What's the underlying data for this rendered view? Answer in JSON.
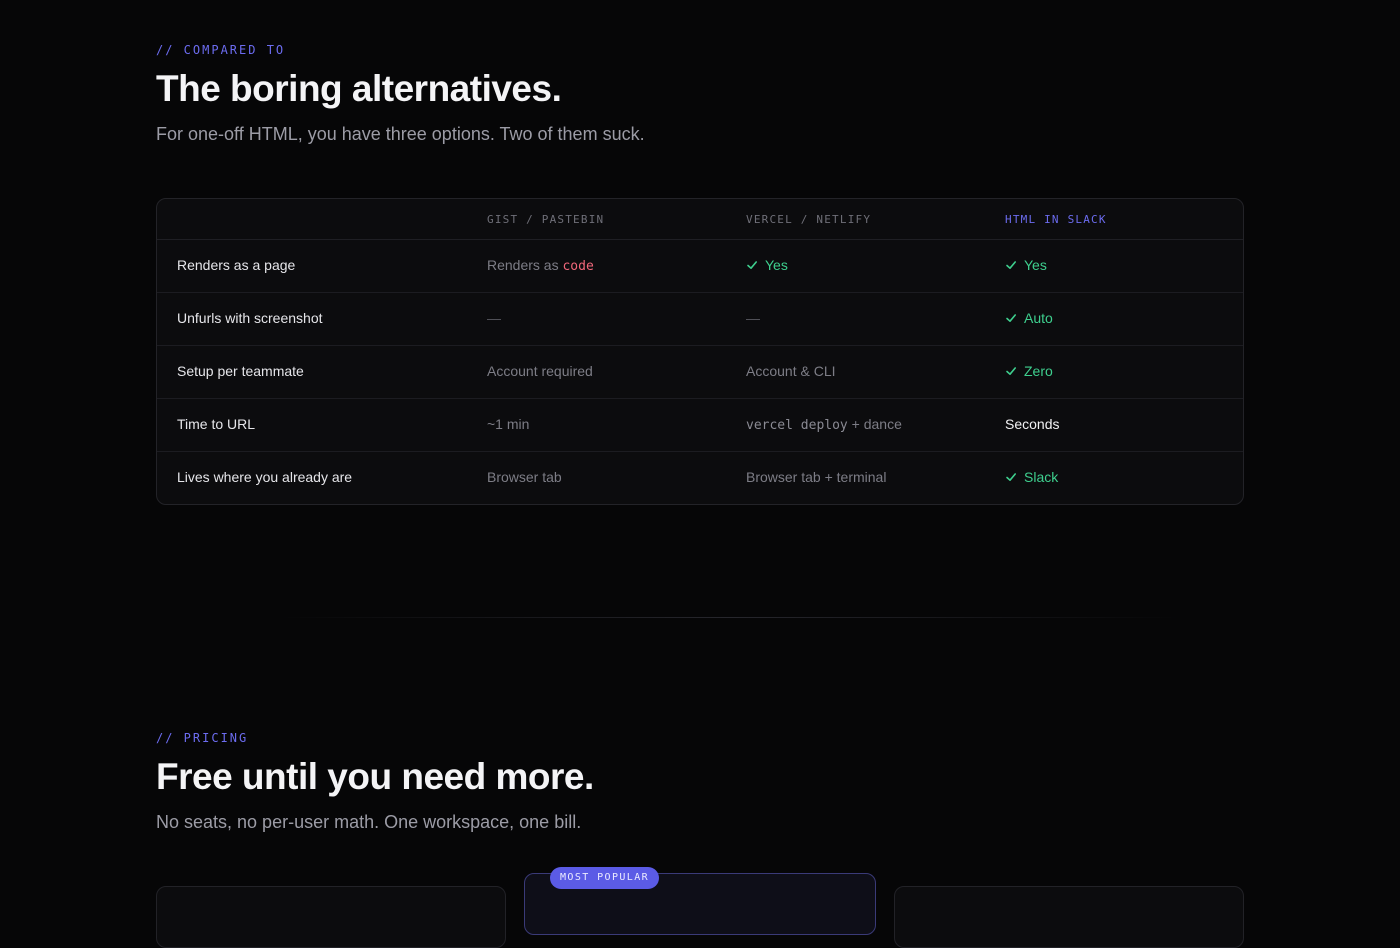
{
  "compare": {
    "eyebrow": "// COMPARED TO",
    "title": "The boring alternatives.",
    "subtitle": "For one-off HTML, you have three options. Two of them suck.",
    "columns": [
      "GIST / PASTEBIN",
      "VERCEL / NETLIFY",
      "HTML IN SLACK"
    ],
    "rows": [
      {
        "label": "Renders as a page",
        "gist_prefix": "Renders as ",
        "gist_code": "code",
        "vercel": "Yes",
        "slack": "Yes"
      },
      {
        "label": "Unfurls with screenshot",
        "gist": "—",
        "vercel": "—",
        "slack": "Auto"
      },
      {
        "label": "Setup per teammate",
        "gist": "Account required",
        "vercel": "Account & CLI",
        "slack": "Zero"
      },
      {
        "label": "Time to URL",
        "gist": "~1 min",
        "vercel_cmd": "vercel deploy",
        "vercel_suffix": " + dance",
        "slack": "Seconds"
      },
      {
        "label": "Lives where you already are",
        "gist": "Browser tab",
        "vercel": "Browser tab + terminal",
        "slack": "Slack"
      }
    ]
  },
  "pricing": {
    "eyebrow": "// PRICING",
    "title": "Free until you need more.",
    "subtitle": "No seats, no per-user math. One workspace, one bill.",
    "badge": "MOST POPULAR"
  },
  "icons": {
    "check": "check-icon"
  },
  "colors": {
    "accent": "#6c6cf0",
    "good": "#3ecf8e",
    "code": "#f0677a",
    "background": "#060607"
  }
}
